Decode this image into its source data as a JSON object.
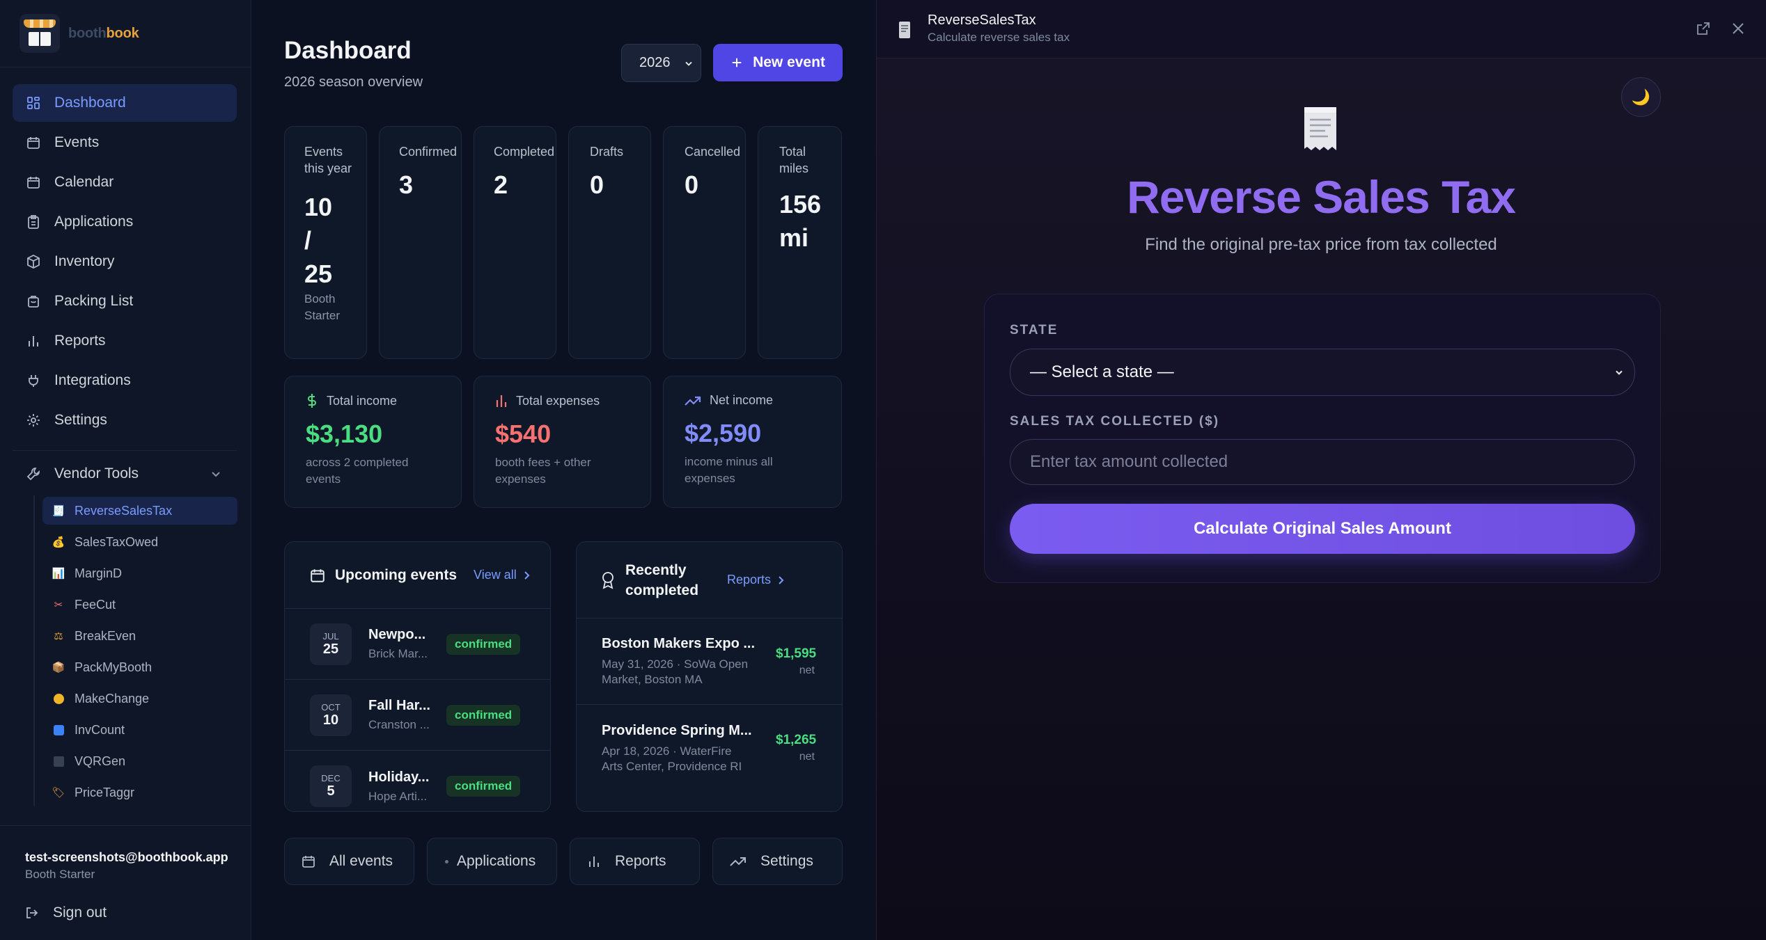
{
  "brand": {
    "name_part1": "booth",
    "name_part2": "book"
  },
  "sidebar": {
    "nav": [
      {
        "label": "Dashboard",
        "icon": "grid-icon",
        "active": true
      },
      {
        "label": "Events",
        "icon": "calendar-icon"
      },
      {
        "label": "Calendar",
        "icon": "calendar-icon"
      },
      {
        "label": "Applications",
        "icon": "clipboard-icon"
      },
      {
        "label": "Inventory",
        "icon": "box-icon"
      },
      {
        "label": "Packing List",
        "icon": "bag-icon"
      },
      {
        "label": "Reports",
        "icon": "bar-chart-icon"
      },
      {
        "label": "Integrations",
        "icon": "plug-icon"
      },
      {
        "label": "Settings",
        "icon": "gear-icon"
      }
    ],
    "vendor_tools_label": "Vendor Tools",
    "tools": [
      {
        "label": "ReverseSalesTax",
        "glyph": "🧾",
        "active": true
      },
      {
        "label": "SalesTaxOwed",
        "glyph": "💰"
      },
      {
        "label": "MarginD",
        "glyph": "📊"
      },
      {
        "label": "FeeCut",
        "glyph": "✂"
      },
      {
        "label": "BreakEven",
        "glyph": "⚖"
      },
      {
        "label": "PackMyBooth",
        "glyph": "📦"
      },
      {
        "label": "MakeChange",
        "glyph": "🪙"
      },
      {
        "label": "InvCount",
        "glyph": "🔢"
      },
      {
        "label": "VQRGen",
        "glyph": "▦"
      },
      {
        "label": "PriceTaggr",
        "glyph": "🏷"
      }
    ],
    "user_email": "test-screenshots@boothbook.app",
    "user_plan": "Booth Starter",
    "sign_out": "Sign out"
  },
  "dashboard": {
    "title": "Dashboard",
    "subtitle": "2026 season overview",
    "year": "2026",
    "new_event": "New event",
    "stats": [
      {
        "label": "Events this year",
        "value": "10 / 25",
        "sub": "Booth Starter"
      },
      {
        "label": "Confirmed",
        "value": "3"
      },
      {
        "label": "Completed",
        "value": "2"
      },
      {
        "label": "Drafts",
        "value": "0"
      },
      {
        "label": "Cancelled",
        "value": "0"
      },
      {
        "label": "Total miles",
        "value": "156 mi"
      }
    ],
    "money": [
      {
        "label": "Total income",
        "value": "$3,130",
        "sub": "across 2 completed events",
        "color": "#4ade80"
      },
      {
        "label": "Total expenses",
        "value": "$540",
        "sub": "booth fees + other expenses",
        "color": "#f87171"
      },
      {
        "label": "Net income",
        "value": "$2,590",
        "sub": "income minus all expenses",
        "color": "#818cf8"
      }
    ],
    "upcoming": {
      "title": "Upcoming events",
      "view_all": "View all",
      "items": [
        {
          "month": "JUL",
          "day": "25",
          "name": "Newpo...",
          "place": "Brick Mar...",
          "status": "confirmed"
        },
        {
          "month": "OCT",
          "day": "10",
          "name": "Fall Har...",
          "place": "Cranston ...",
          "status": "confirmed"
        },
        {
          "month": "DEC",
          "day": "5",
          "name": "Holiday...",
          "place": "Hope Arti...",
          "status": "confirmed"
        }
      ]
    },
    "recent": {
      "title_line1": "Recently",
      "title_line2": "completed",
      "reports_link": "Reports",
      "items": [
        {
          "name": "Boston Makers Expo ...",
          "meta1": "May 31, 2026 · SoWa Open",
          "meta2": "Market, Boston MA",
          "amount": "$1,595",
          "net": "net"
        },
        {
          "name": "Providence Spring M...",
          "meta1": "Apr 18, 2026 · WaterFire",
          "meta2": "Arts Center, Providence RI",
          "amount": "$1,265",
          "net": "net"
        }
      ]
    },
    "quick": [
      {
        "label": "All events",
        "icon": "calendar-icon"
      },
      {
        "label": "Applications",
        "icon": "dot-icon"
      },
      {
        "label": "Reports",
        "icon": "bar-chart-icon"
      },
      {
        "label": "Settings",
        "icon": "trend-icon"
      }
    ]
  },
  "panel": {
    "title": "ReverseSalesTax",
    "subtitle": "Calculate reverse sales tax",
    "theme_glyph": "🌙",
    "hero_glyph": "🧾",
    "heading": "Reverse Sales Tax",
    "tagline": "Find the original pre-tax price from tax collected",
    "state_label": "STATE",
    "state_value": "— Select a state —",
    "tax_label": "SALES TAX COLLECTED ($)",
    "tax_placeholder": "Enter tax amount collected",
    "button": "Calculate Original Sales Amount"
  }
}
